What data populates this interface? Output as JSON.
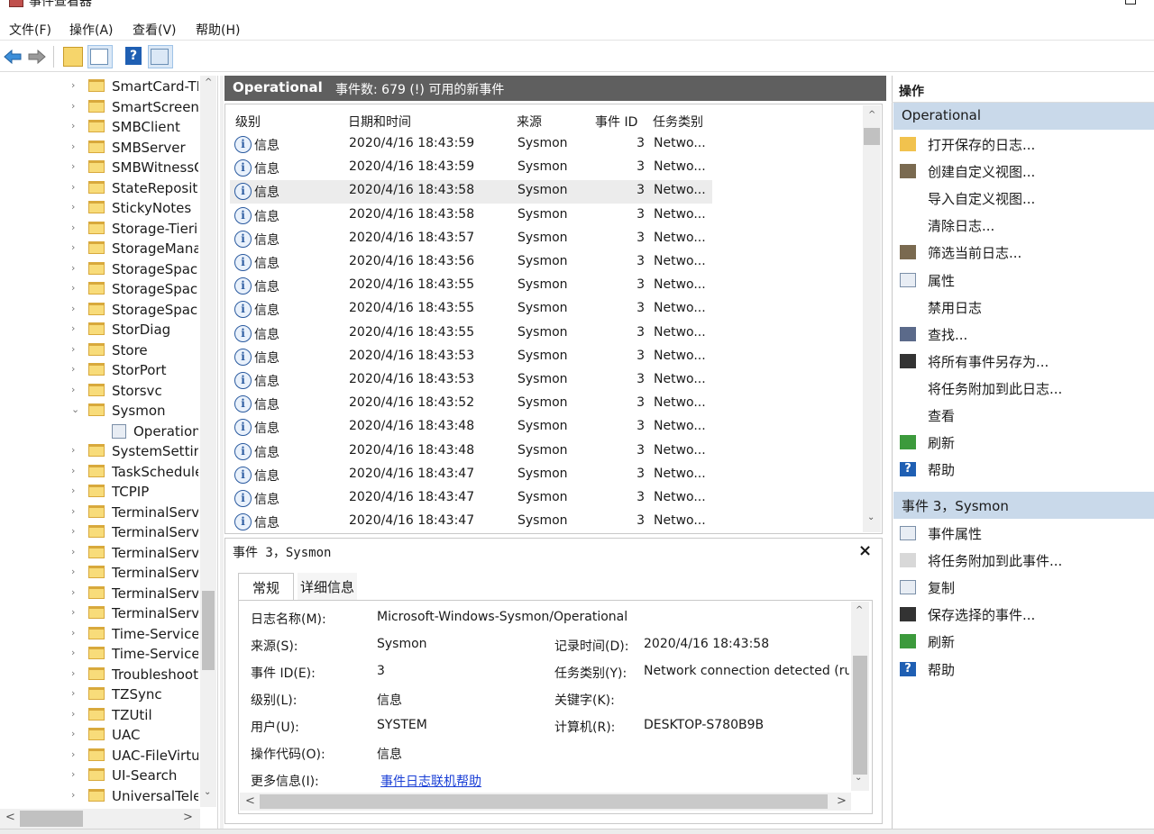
{
  "window": {
    "title": "事件查看器"
  },
  "menu": [
    "文件(F)",
    "操作(A)",
    "查看(V)",
    "帮助(H)"
  ],
  "toolbar": {
    "help_glyph": "?"
  },
  "tree": {
    "items": [
      "SmartCard-TP",
      "SmartScreen",
      "SMBClient",
      "SMBServer",
      "SMBWitnessC",
      "StateReposito",
      "StickyNotes",
      "Storage-Tierir",
      "StorageManag",
      "StorageSpace",
      "StorageSpace",
      "StorageSpace",
      "StorDiag",
      "Store",
      "StorPort",
      "Storsvc",
      "Sysmon",
      "Operationa",
      "SystemSetting",
      "TaskSchedule",
      "TCPIP",
      "TerminalServi",
      "TerminalServi",
      "TerminalServi",
      "TerminalServi",
      "TerminalServi",
      "TerminalServi",
      "Time-Service",
      "Time-Service-",
      "Troubleshooti",
      "TZSync",
      "TZUtil",
      "UAC",
      "UAC-FileVirtu",
      "UI-Search",
      "UniversalTeler"
    ],
    "chev_collapsed": "›",
    "chev_expanded": "⌄",
    "scroll_up": "^",
    "scroll_down": "⌄",
    "scroll_left": "<",
    "scroll_right": ">"
  },
  "log_header": {
    "title": "Operational",
    "count_text": "事件数: 679 (!) 可用的新事件"
  },
  "grid": {
    "columns": [
      "级别",
      "日期和时间",
      "来源",
      "事件 ID",
      "任务类别"
    ],
    "info_glyph": "i",
    "rows": [
      {
        "level": "信息",
        "datetime": "2020/4/16 18:43:59",
        "source": "Sysmon",
        "id": "3",
        "task": "Netwo..."
      },
      {
        "level": "信息",
        "datetime": "2020/4/16 18:43:59",
        "source": "Sysmon",
        "id": "3",
        "task": "Netwo..."
      },
      {
        "level": "信息",
        "datetime": "2020/4/16 18:43:58",
        "source": "Sysmon",
        "id": "3",
        "task": "Netwo..."
      },
      {
        "level": "信息",
        "datetime": "2020/4/16 18:43:58",
        "source": "Sysmon",
        "id": "3",
        "task": "Netwo..."
      },
      {
        "level": "信息",
        "datetime": "2020/4/16 18:43:57",
        "source": "Sysmon",
        "id": "3",
        "task": "Netwo..."
      },
      {
        "level": "信息",
        "datetime": "2020/4/16 18:43:56",
        "source": "Sysmon",
        "id": "3",
        "task": "Netwo..."
      },
      {
        "level": "信息",
        "datetime": "2020/4/16 18:43:55",
        "source": "Sysmon",
        "id": "3",
        "task": "Netwo..."
      },
      {
        "level": "信息",
        "datetime": "2020/4/16 18:43:55",
        "source": "Sysmon",
        "id": "3",
        "task": "Netwo..."
      },
      {
        "level": "信息",
        "datetime": "2020/4/16 18:43:55",
        "source": "Sysmon",
        "id": "3",
        "task": "Netwo..."
      },
      {
        "level": "信息",
        "datetime": "2020/4/16 18:43:53",
        "source": "Sysmon",
        "id": "3",
        "task": "Netwo..."
      },
      {
        "level": "信息",
        "datetime": "2020/4/16 18:43:53",
        "source": "Sysmon",
        "id": "3",
        "task": "Netwo..."
      },
      {
        "level": "信息",
        "datetime": "2020/4/16 18:43:52",
        "source": "Sysmon",
        "id": "3",
        "task": "Netwo..."
      },
      {
        "level": "信息",
        "datetime": "2020/4/16 18:43:48",
        "source": "Sysmon",
        "id": "3",
        "task": "Netwo..."
      },
      {
        "level": "信息",
        "datetime": "2020/4/16 18:43:48",
        "source": "Sysmon",
        "id": "3",
        "task": "Netwo..."
      },
      {
        "level": "信息",
        "datetime": "2020/4/16 18:43:47",
        "source": "Sysmon",
        "id": "3",
        "task": "Netwo..."
      },
      {
        "level": "信息",
        "datetime": "2020/4/16 18:43:47",
        "source": "Sysmon",
        "id": "3",
        "task": "Netwo..."
      },
      {
        "level": "信息",
        "datetime": "2020/4/16 18:43:47",
        "source": "Sysmon",
        "id": "3",
        "task": "Netwo..."
      }
    ],
    "scroll_up": "^",
    "scroll_down": "⌄"
  },
  "detail": {
    "title": "事件 3，Sysmon",
    "close": "×",
    "tabs": [
      "常规",
      "详细信息"
    ],
    "fields": {
      "log_name_label": "日志名称(M):",
      "log_name": "Microsoft-Windows-Sysmon/Operational",
      "source_label": "来源(S):",
      "source": "Sysmon",
      "logged_label": "记录时间(D):",
      "logged": "2020/4/16 18:43:58",
      "event_id_label": "事件 ID(E):",
      "event_id": "3",
      "task_label": "任务类别(Y):",
      "task": "Network connection detected (ru",
      "level_label": "级别(L):",
      "level": "信息",
      "keywords_label": "关键字(K):",
      "user_label": "用户(U):",
      "user": "SYSTEM",
      "computer_label": "计算机(R):",
      "computer": "DESKTOP-S780B9B",
      "opcode_label": "操作代码(O):",
      "opcode": "信息",
      "more_info_label": "更多信息(I):",
      "more_info_link": "事件日志联机帮助"
    },
    "scroll_up": "^",
    "scroll_down": "⌄",
    "scroll_left": "<",
    "scroll_right": ">"
  },
  "actions": {
    "header": "操作",
    "group1": "Operational",
    "group1_items": [
      "打开保存的日志...",
      "创建自定义视图...",
      "导入自定义视图...",
      "清除日志...",
      "筛选当前日志...",
      "属性",
      "禁用日志",
      "查找...",
      "将所有事件另存为...",
      "将任务附加到此日志...",
      "查看",
      "刷新",
      "帮助"
    ],
    "group2": "事件 3，Sysmon",
    "group2_items": [
      "事件属性",
      "将任务附加到此事件...",
      "复制",
      "保存选择的事件...",
      "刷新",
      "帮助"
    ],
    "help_glyph": "?"
  },
  "colors": {
    "accent": "#c9d9ea",
    "header_dark": "#5f5f5f",
    "link": "#1a3fd6"
  }
}
